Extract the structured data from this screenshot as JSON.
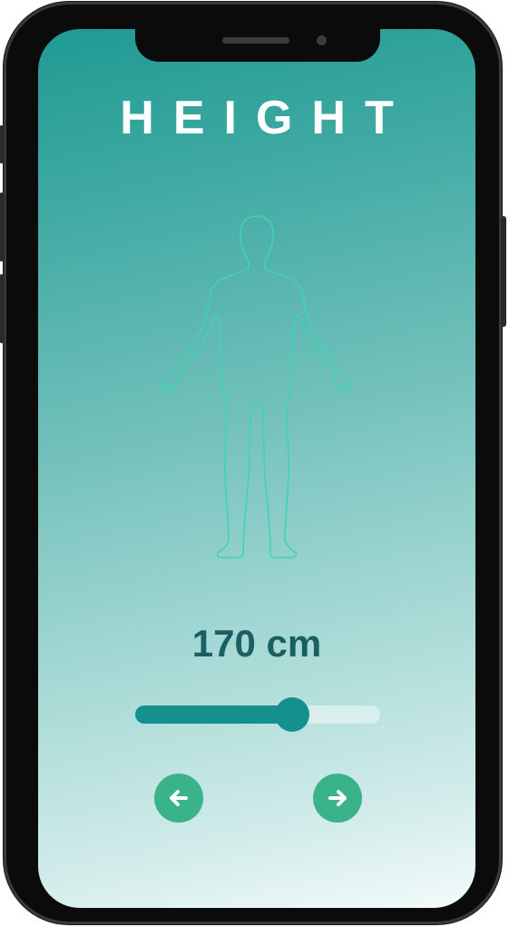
{
  "screen": {
    "title": "HEIGHT",
    "figure": {
      "icon": "human-body-outline-icon",
      "stroke_color": "#3fd4b3"
    },
    "height_display": "170 cm",
    "slider": {
      "fill_fraction": 0.64,
      "fill_color": "#14918f"
    },
    "nav": {
      "back_icon": "arrow-left-icon",
      "next_icon": "arrow-right-icon",
      "button_color": "#3ab28a"
    }
  }
}
